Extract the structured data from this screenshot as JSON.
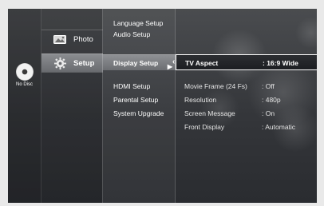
{
  "disc": {
    "label": "No Disc",
    "icon": "disc-icon"
  },
  "categories": [
    {
      "label": "Photo",
      "icon": "photo-icon"
    },
    {
      "label": "Setup",
      "icon": "gear-icon"
    }
  ],
  "setup_menu": [
    {
      "label": "Language Setup"
    },
    {
      "label": "Audio Setup"
    },
    {
      "label": "Display Setup"
    },
    {
      "label": "HDMI Setup"
    },
    {
      "label": "Parental Setup"
    },
    {
      "label": "System Upgrade"
    }
  ],
  "display_options": [
    {
      "name": "TV Aspect",
      "value": ": 16:9 Wide"
    },
    {
      "name": "Movie Frame (24 Fs)",
      "value": ": Off"
    },
    {
      "name": "Resolution",
      "value": ": 480p"
    },
    {
      "name": "Screen Message",
      "value": ": On"
    },
    {
      "name": "Front Display",
      "value": ": Automatic"
    }
  ],
  "colors": {
    "highlight_border": "#ffffff",
    "panel_bg": "#3a3c40"
  }
}
